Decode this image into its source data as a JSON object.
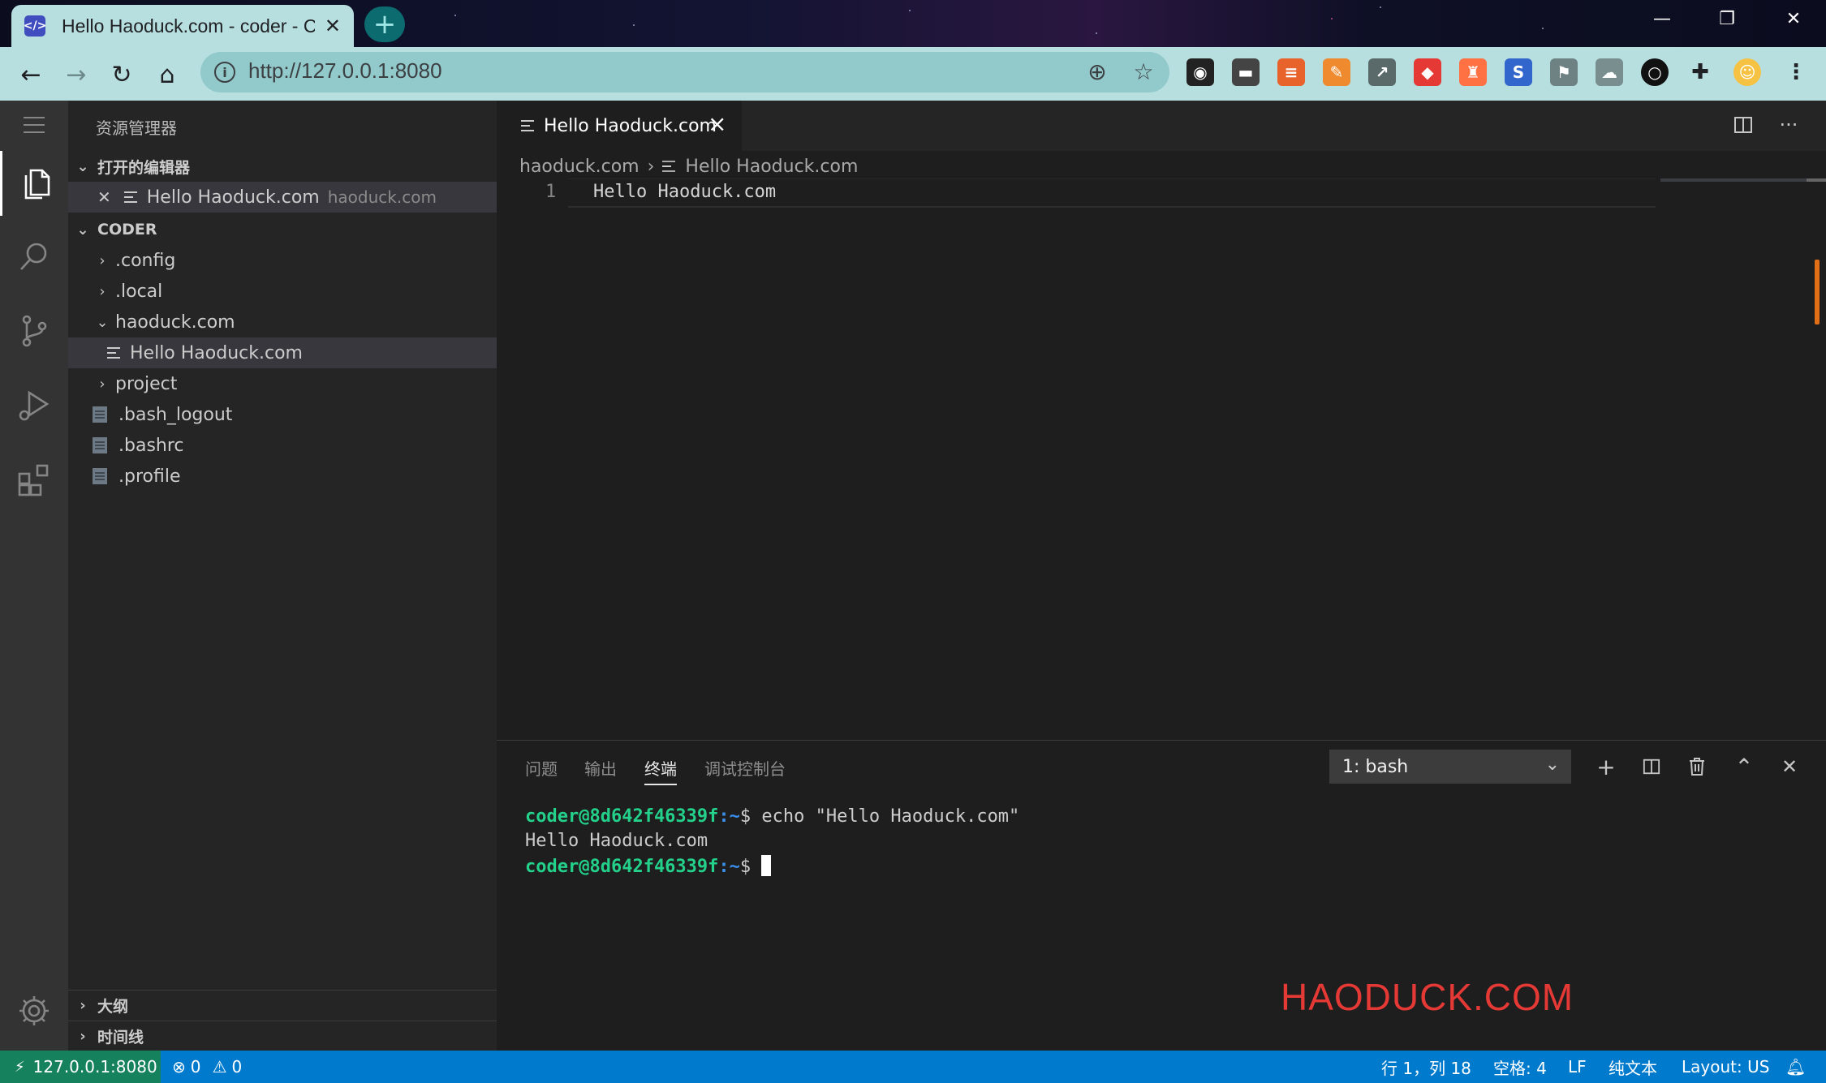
{
  "browser": {
    "tab_title": "Hello Haoduck.com - coder - Code",
    "tab_favicon": "code-server",
    "new_tab": "+",
    "url": "http://127.0.0.1:8080"
  },
  "activity_bar": {
    "items": [
      "menu-icon",
      "explorer-icon",
      "search-icon",
      "source-control-icon",
      "run-debug-icon",
      "extensions-icon"
    ],
    "settings": "gear-icon"
  },
  "sidebar": {
    "title": "资源管理器",
    "open_editors": {
      "label": "打开的编辑器",
      "items": [
        {
          "name": "Hello Haoduck.com",
          "folder": "haoduck.com"
        }
      ]
    },
    "workspace": {
      "label": "CODER",
      "tree": [
        {
          "name": ".config",
          "type": "folder"
        },
        {
          "name": ".local",
          "type": "folder"
        },
        {
          "name": "haoduck.com",
          "type": "folder-open"
        },
        {
          "name": "Hello Haoduck.com",
          "type": "file"
        },
        {
          "name": "project",
          "type": "folder"
        },
        {
          "name": ".bash_logout",
          "type": "file"
        },
        {
          "name": ".bashrc",
          "type": "file"
        },
        {
          "name": ".profile",
          "type": "file"
        }
      ]
    },
    "outline_label": "大纲",
    "timeline_label": "时间线"
  },
  "editor": {
    "tab_label": "Hello Haoduck.com",
    "breadcrumb": {
      "folder": "haoduck.com",
      "separator": "›",
      "file": "Hello Haoduck.com"
    },
    "lines": [
      {
        "number": "1",
        "text": "Hello Haoduck.com"
      }
    ]
  },
  "panel": {
    "tabs": [
      "问题",
      "输出",
      "终端",
      "调试控制台"
    ],
    "active_tab": "终端",
    "terminal_select": "1: bash",
    "terminal": {
      "user": "coder@8d642f46339f",
      "path": ":~",
      "prompt": "$",
      "command": " echo \"Hello Haoduck.com\"",
      "output": "Hello Haoduck.com"
    }
  },
  "watermark": "HAODUCK.COM",
  "status_bar": {
    "remote": "127.0.0.1:8080",
    "errors": "0",
    "warnings": "0",
    "position": "行 1，列 18",
    "spaces": "空格: 4",
    "eol": "LF",
    "language": "纯文本",
    "layout": "Layout: US"
  },
  "colors": {
    "status_bar": "#007acc",
    "remote_badge": "#16825d",
    "terminal_user": "#23d18b",
    "terminal_path": "#3b8eea",
    "watermark": "#e53935"
  }
}
